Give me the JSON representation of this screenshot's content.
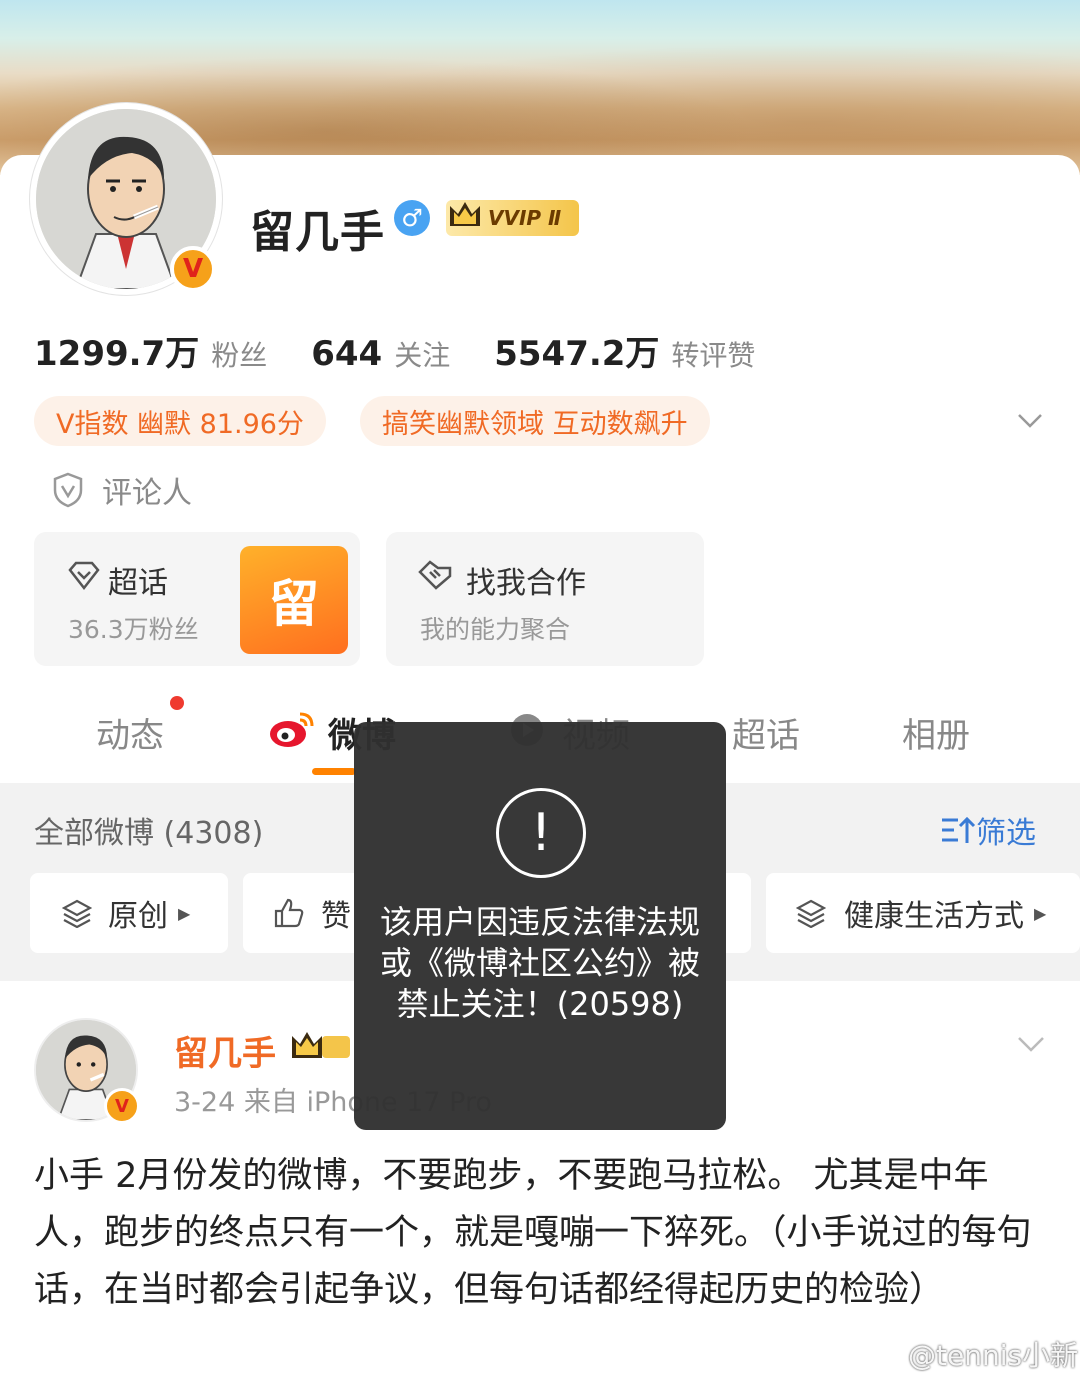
{
  "profile": {
    "name": "留几手",
    "gender_symbol": "♂",
    "vip_label": "VVIP Ⅱ",
    "verified_mark": "V"
  },
  "stats": [
    {
      "value": "1299.7万",
      "label": "粉丝"
    },
    {
      "value": "644",
      "label": "关注"
    },
    {
      "value": "5547.2万",
      "label": "转评赞"
    }
  ],
  "tags": {
    "v_index": "V指数 幽默 81.96分",
    "field": "搞笑幽默领域 互动数飙升"
  },
  "role": "评论人",
  "tiles": {
    "supertopic": {
      "title": "超话",
      "subtitle": "36.3万粉丝",
      "logo_char": "留"
    },
    "cooperate": {
      "title": "找我合作",
      "subtitle": "我的能力聚合"
    }
  },
  "tabs": [
    "动态",
    "微博",
    "视频",
    "超话",
    "相册"
  ],
  "active_tab": "微博",
  "feed": {
    "all_label": "全部微博 (4308)",
    "filter_label": "筛选",
    "chips": [
      "原创",
      "赞",
      "健康生活方式"
    ]
  },
  "post": {
    "author": "留几手",
    "meta": "3-24  来自 iPhone 17 Pro",
    "text": "小手 2月份发的微博，不要跑步，不要跑马拉松。 尤其是中年人，跑步的终点只有一个，就是嘎嘣一下猝死。（小手说过的每句话，在当时都会引起争议，但每句话都经得起历史的检验）"
  },
  "toast": {
    "icon": "!",
    "message": "该用户因违反法律法规或《微博社区公约》被禁止关注！(20598)"
  },
  "watermark": "@tennis小新",
  "colors": {
    "accent": "#ff8200",
    "orange_text": "#f06a25",
    "link_blue": "#3a7bd5"
  }
}
